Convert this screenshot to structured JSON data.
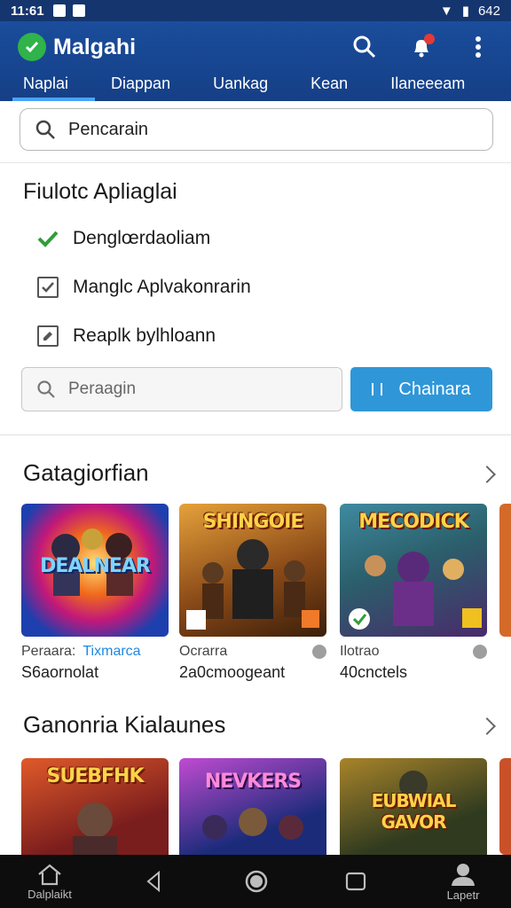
{
  "status": {
    "time": "11:61",
    "battery": "642"
  },
  "app": {
    "title": "Malgahi"
  },
  "tabs": [
    "Naplai",
    "Diappan",
    "Uankag",
    "Kean",
    "Ilaneeeam"
  ],
  "search": {
    "placeholder": "Pencarain"
  },
  "filter": {
    "title": "Fiulotc Apliaglai",
    "items": [
      "Denglœrdaoliam",
      "Manglc Aplvakonrarin",
      "Reaplk bylhloann"
    ],
    "search_placeholder": "Peraagin",
    "button_label": "Chainara"
  },
  "section1": {
    "title": "Gatagiorfian",
    "cards": [
      {
        "art": "DEALNEAR",
        "meta_a": "Peraara:",
        "meta_b": "Tixmarca",
        "sub": "S6aornolat",
        "colors": [
          "#1e3fae",
          "#f06a1a"
        ]
      },
      {
        "art": "SHINGOIE",
        "meta_a": "Ocrarra",
        "meta_b": "",
        "sub": "2a0cmoogeant",
        "colors": [
          "#6b3b14",
          "#e6a13a"
        ]
      },
      {
        "art": "MECODICK",
        "meta_a": "Ilotrao",
        "meta_b": "",
        "sub": "40cnctels",
        "colors": [
          "#2b5f6b",
          "#7d4aa6"
        ]
      }
    ]
  },
  "section2": {
    "title": "Ganonria Kialaunes",
    "cards": [
      {
        "art": "SUEBFHK",
        "colors": [
          "#7a1d1d",
          "#e05a2a"
        ]
      },
      {
        "art": "NEVKERS",
        "colors": [
          "#1b2b7a",
          "#c04bd1"
        ]
      },
      {
        "art": "EUBWIAL GAVOR",
        "colors": [
          "#2f3a1f",
          "#a8842a"
        ]
      }
    ]
  },
  "nav": {
    "home": "Dalplaikt",
    "profile": "Lapetr"
  }
}
